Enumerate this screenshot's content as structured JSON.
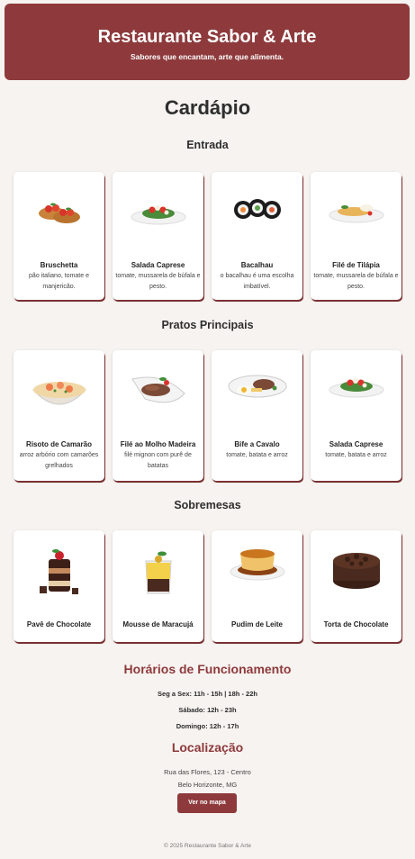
{
  "header": {
    "title": "Restaurante Sabor & Arte",
    "tagline": "Sabores que encantam, arte que alimenta."
  },
  "menu": {
    "title": "Cardápio",
    "sections": [
      {
        "title": "Entrada",
        "items": [
          {
            "name": "Bruschetta",
            "desc": "pão italiano, tomate e manjericão.",
            "icon": "bruschetta-image"
          },
          {
            "name": "Salada Caprese",
            "desc": "tomate, mussarela de búfala e pesto.",
            "icon": "salad-image"
          },
          {
            "name": "Bacalhau",
            "desc": "o bacalhau é uma escolha imbatível.",
            "icon": "sushi-image"
          },
          {
            "name": "Filé de Tilápia",
            "desc": "tomate, mussarela de búfala e pesto.",
            "icon": "fish-fillet-image"
          }
        ]
      },
      {
        "title": "Pratos Principais",
        "items": [
          {
            "name": "Risoto de Camarão",
            "desc": "arroz arbório com camarões grelhados",
            "icon": "risotto-image"
          },
          {
            "name": "Filé ao Molho Madeira",
            "desc": "filé mignon com purê de batatas",
            "icon": "steak-image"
          },
          {
            "name": "Bife a Cavalo",
            "desc": "tomate, batata e arroz",
            "icon": "steak-egg-image"
          },
          {
            "name": "Salada Caprese",
            "desc": "tomate, batata e arroz",
            "icon": "salad-image"
          }
        ]
      },
      {
        "title": "Sobremesas",
        "items": [
          {
            "name": "Pavê de Chocolate",
            "desc": "",
            "icon": "chocolate-dessert-image"
          },
          {
            "name": "Mousse de Maracujá",
            "desc": "",
            "icon": "mousse-image"
          },
          {
            "name": "Pudim de Leite",
            "desc": "",
            "icon": "pudding-image"
          },
          {
            "name": "Torta de Chocolate",
            "desc": "",
            "icon": "chocolate-cake-image"
          }
        ]
      }
    ]
  },
  "hours": {
    "title": "Horários de Funcionamento",
    "lines": [
      "Seg a Sex: 11h - 15h | 18h - 22h",
      "Sábado: 12h - 23h",
      "Domingo: 12h - 17h"
    ]
  },
  "location": {
    "title": "Localização",
    "address_line1": "Rua das Flores, 123 - Centro",
    "address_line2": "Belo Horizonte, MG",
    "map_button": "Ver no mapa"
  },
  "footer": "© 2025 Restaurante Sabor & Arte",
  "colors": {
    "brand": "#8e3a3c",
    "background": "#f7f3f0"
  }
}
